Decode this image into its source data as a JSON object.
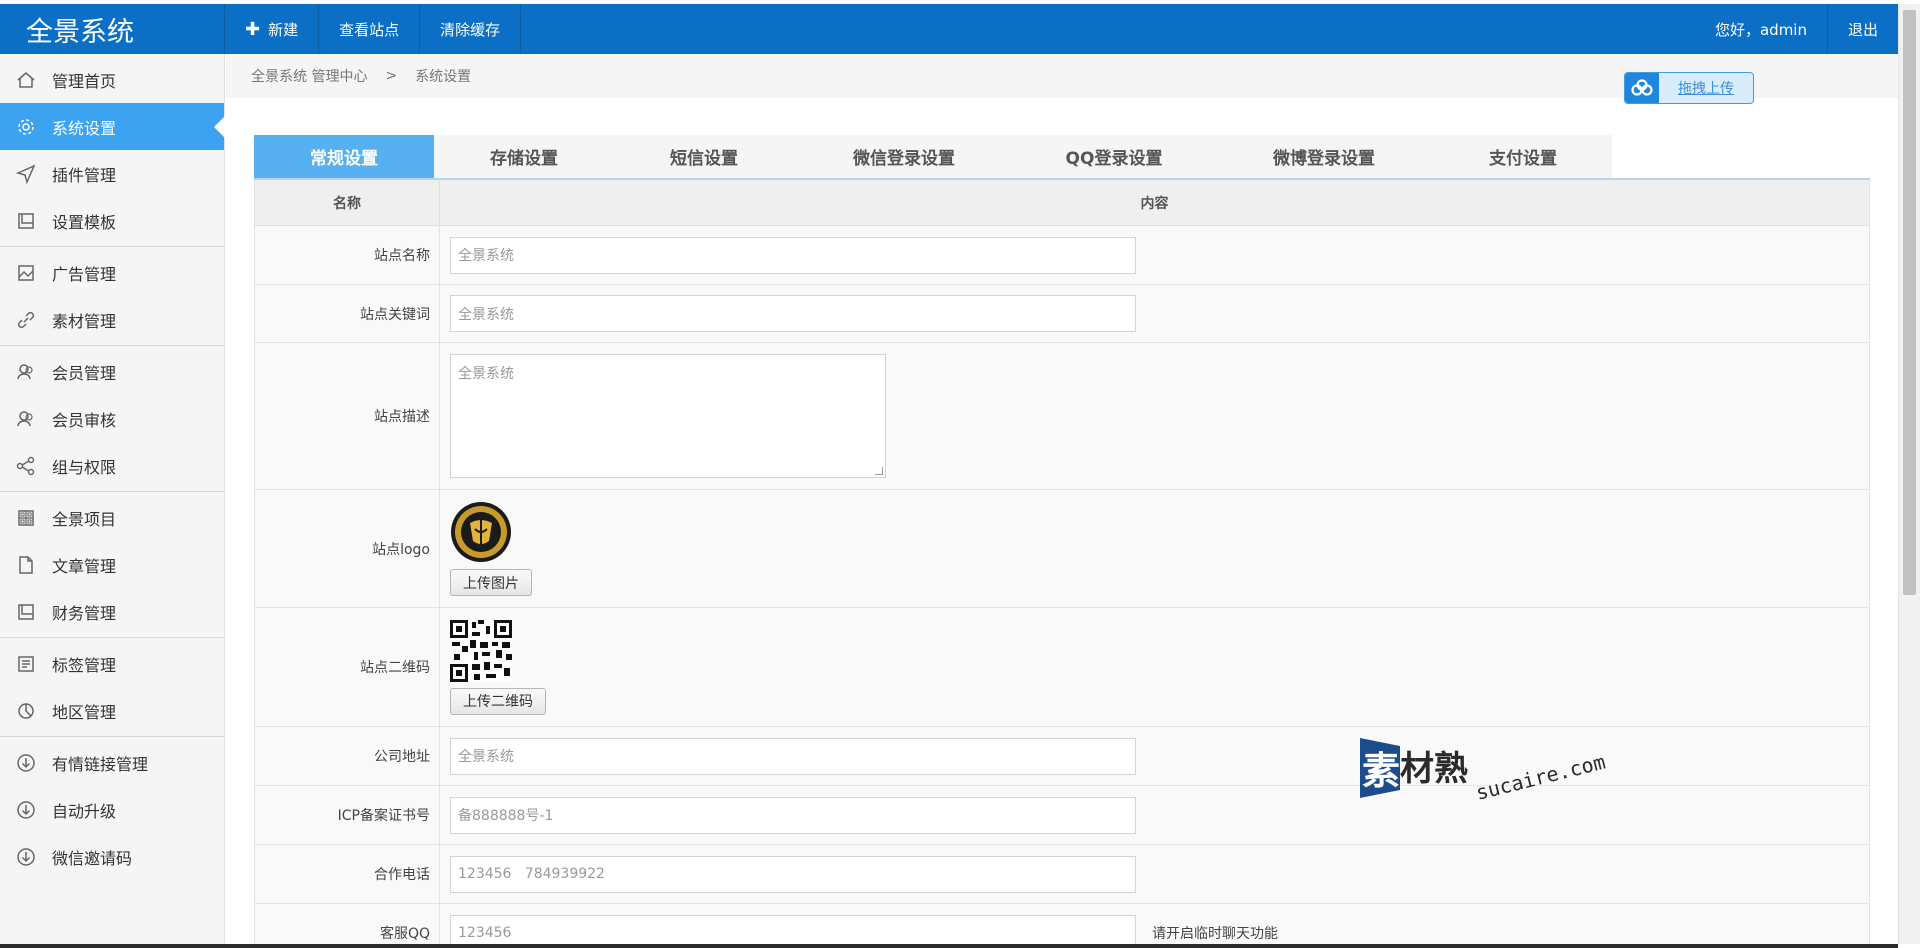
{
  "app": {
    "title": "全景系统"
  },
  "topnav": {
    "new_label": "新建",
    "view_site": "查看站点",
    "clear_cache": "清除缓存"
  },
  "user": {
    "greeting": "您好，admin",
    "logout": "退出"
  },
  "sidebar": {
    "groups": [
      [
        {
          "label": "管理首页",
          "icon": "home-icon"
        },
        {
          "label": "系统设置",
          "icon": "gear-icon",
          "active": true
        },
        {
          "label": "插件管理",
          "icon": "send-icon"
        },
        {
          "label": "设置模板",
          "icon": "book-icon"
        }
      ],
      [
        {
          "label": "广告管理",
          "icon": "image-icon"
        },
        {
          "label": "素材管理",
          "icon": "link-icon"
        }
      ],
      [
        {
          "label": "会员管理",
          "icon": "users-icon"
        },
        {
          "label": "会员审核",
          "icon": "users-icon"
        },
        {
          "label": "组与权限",
          "icon": "share-icon"
        }
      ],
      [
        {
          "label": "全景项目",
          "icon": "grid-icon"
        },
        {
          "label": "文章管理",
          "icon": "file-icon"
        },
        {
          "label": "财务管理",
          "icon": "book-icon"
        }
      ],
      [
        {
          "label": "标签管理",
          "icon": "list-icon"
        },
        {
          "label": "地区管理",
          "icon": "pie-icon"
        }
      ],
      [
        {
          "label": "有情链接管理",
          "icon": "download-icon"
        },
        {
          "label": "自动升级",
          "icon": "download-icon"
        },
        {
          "label": "微信邀请码",
          "icon": "download-icon"
        }
      ]
    ]
  },
  "breadcrumb": {
    "root": "全景系统 管理中心",
    "sep": ">",
    "current": "系统设置"
  },
  "upload": {
    "label": "拖拽上传"
  },
  "tabs": [
    {
      "label": "常规设置",
      "active": true
    },
    {
      "label": "存储设置"
    },
    {
      "label": "短信设置"
    },
    {
      "label": "微信登录设置"
    },
    {
      "label": "QQ登录设置"
    },
    {
      "label": "微博登录设置"
    },
    {
      "label": "支付设置"
    }
  ],
  "table": {
    "head": {
      "name": "名称",
      "content": "内容"
    },
    "site_name": {
      "label": "站点名称",
      "value": "全景系统"
    },
    "site_keywords": {
      "label": "站点关键词",
      "value": "全景系统"
    },
    "site_desc": {
      "label": "站点描述",
      "value": "全景系统"
    },
    "site_logo": {
      "label": "站点logo",
      "button": "上传图片"
    },
    "site_qr": {
      "label": "站点二维码",
      "button": "上传二维码"
    },
    "address": {
      "label": "公司地址",
      "value": "全景系统"
    },
    "icp": {
      "label": "ICP备案证书号",
      "value": "备888888号-1"
    },
    "phone": {
      "label": "合作电话",
      "value": "123456   784939922"
    },
    "qq": {
      "label": "客服QQ",
      "value": "123456",
      "hint": "请开启临时聊天功能"
    }
  },
  "watermark": {
    "brand": "素材熟",
    "domain": "sucaire.com"
  },
  "colors": {
    "topbar": "#0b6fc6",
    "active": "#3ba3f0",
    "tab_active": "#57b0ef"
  }
}
